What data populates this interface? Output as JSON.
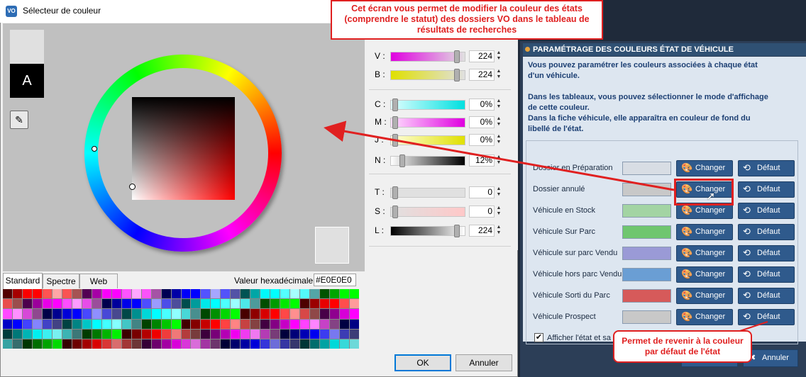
{
  "picker": {
    "title": "Sélecteur de couleur",
    "swatch_letter": "A",
    "tabs": [
      "Standard",
      "Spectre",
      "Web"
    ],
    "hex_label": "Valeur hexadécimale :",
    "hex_value": "#E0E0E0",
    "ok_label": "OK",
    "cancel_label": "Annuler",
    "current_color": "#E0E0E0",
    "sliders": [
      {
        "label": "V :",
        "value": "224",
        "fill": "linear-gradient(to right,#e000e0,#e0e0e0)"
      },
      {
        "label": "B :",
        "value": "224",
        "fill": "linear-gradient(to right,#e0e000,#e0e0e0)"
      },
      {
        "label": "C :",
        "value": "0%",
        "fill": "linear-gradient(to right,#e0ffff,#00e0e0)"
      },
      {
        "label": "M :",
        "value": "0%",
        "fill": "linear-gradient(to right,#ffe0ff,#e000e0)"
      },
      {
        "label": "J :",
        "value": "0%",
        "fill": "linear-gradient(to right,#ffffe0,#e0e000)"
      },
      {
        "label": "N :",
        "value": "12%",
        "fill": "linear-gradient(to right,#ffffff,#000000)"
      },
      {
        "label": "T :",
        "value": "0",
        "fill": "linear-gradient(to right,#e0e0e0,#e0e0e0)"
      },
      {
        "label": "S :",
        "value": "0",
        "fill": "linear-gradient(to right,#e0e0e0,#ffc8c8)"
      },
      {
        "label": "L :",
        "value": "224",
        "fill": "linear-gradient(to right,#000000,#ffffff)"
      }
    ]
  },
  "settings": {
    "header": "PARAMÉTRAGE DES COULEURS ÉTAT DE VÉHICULE",
    "desc1": "Vous pouvez paramétrer les couleurs associées à chaque état",
    "desc2": "d'un véhicule.",
    "desc3": "Dans les tableaux, vous pouvez sélectionner le mode d'affichage",
    "desc4": "de cette couleur.",
    "desc5": "Dans la fiche véhicule, elle apparaîtra en couleur de fond du",
    "desc6": "libellé de l'état.",
    "change_label": "Changer",
    "default_label": "Défaut",
    "rows": [
      {
        "label": "Dossier en Préparation",
        "color": "#d8dde4"
      },
      {
        "label": "Dossier annulé",
        "color": "#c8c8c8"
      },
      {
        "label": "Véhicule en Stock",
        "color": "#a3d4a3"
      },
      {
        "label": "Véhicule Sur Parc",
        "color": "#6fc66f"
      },
      {
        "label": "Véhicule sur parc Vendu",
        "color": "#9a9ad6"
      },
      {
        "label": "Véhicule hors parc Vendu",
        "color": "#6a9ed4"
      },
      {
        "label": "Véhicule Sorti du Parc",
        "color": "#d65a5a"
      },
      {
        "label": "Véhicule Prospect",
        "color": "#c8c8c8"
      }
    ],
    "checkbox_label": "Afficher l'état et sa",
    "cancel_label": "Annuler"
  },
  "callouts": {
    "top": "Cet écran vous permet de modifier la couleur des états (comprendre le statut) des dossiers VO dans le tableau de résultats de recherches",
    "bottom": "Permet de revenir à la couleur par défaut de l'état"
  },
  "palette_colors": [
    "#400000",
    "#800000",
    "#c00000",
    "#ff0000",
    "#ff4040",
    "#ff8080",
    "#c04040",
    "#804040",
    "#400040",
    "#800080",
    "#c000c0",
    "#ff00ff",
    "#ff40ff",
    "#ff80ff",
    "#c040c0",
    "#804080",
    "#000040",
    "#000080",
    "#0000c0",
    "#0000ff",
    "#4040ff",
    "#8080ff",
    "#4040c0",
    "#404080",
    "#004040",
    "#008080",
    "#00c0c0",
    "#00ffff",
    "#40ffff",
    "#80ffff",
    "#40c0c0",
    "#408080",
    "#004000",
    "#008000",
    "#00c000",
    "#00ff00"
  ]
}
